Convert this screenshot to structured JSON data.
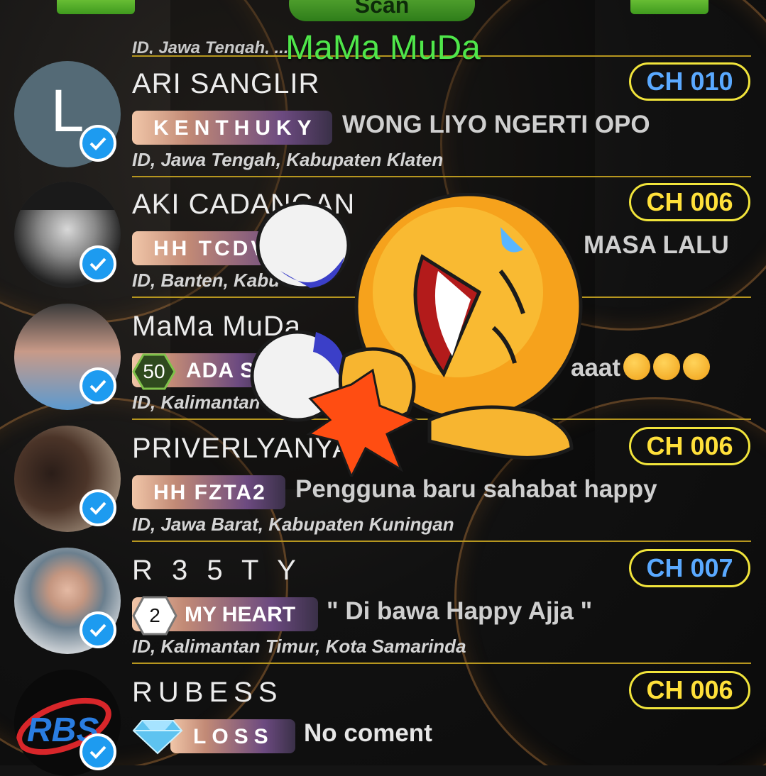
{
  "header": {
    "scan_label": "Scan",
    "room_title": "MaMa MuDa",
    "clipped_location": "ID, Jawa Tengah, ..."
  },
  "rows": [
    {
      "name": "ARI SANGLIR",
      "avatar_letter": "L",
      "badge": "KENTHUKY",
      "message": "WONG LIYO NGERTI OPO",
      "location": "ID, Jawa Tengah, Kabupaten Klaten",
      "channel": "CH 010",
      "channel_color": "#5aa9ff"
    },
    {
      "name": "AKI CADANGAN",
      "badge": "HH TCDV",
      "message": "MASA LALU",
      "location": "ID, Banten, Kabu",
      "channel": "CH 006",
      "channel_color": "#ffe03a"
    },
    {
      "name": "MaMa MuDa",
      "level": "50",
      "badge": "ADA S",
      "message": "aaat",
      "location": "ID, Kalimantan",
      "channel": "",
      "channel_color": ""
    },
    {
      "name": "PRIVERLYANYA",
      "badge": "HH FZTA2",
      "message": "Pengguna baru sahabat happy",
      "location": "ID, Jawa Barat, Kabupaten Kuningan",
      "channel": "CH 006",
      "channel_color": "#ffe03a"
    },
    {
      "name": "R 3 5 T Y",
      "level": "2",
      "badge": "MY HEART",
      "message": "\" Di bawa Happy Ajja \"",
      "location": "ID, Kalimantan Timur, Kota Samarinda",
      "channel": "CH 007",
      "channel_color": "#5aa9ff"
    },
    {
      "name": "RUBESS",
      "avatar_letter": "RBS",
      "badge": "LOSS",
      "message": "No coment",
      "location": "",
      "channel": "CH 006",
      "channel_color": "#ffe03a"
    }
  ],
  "icons": {
    "verified": "verified-check-icon",
    "diamond": "diamond-icon",
    "sticker": "laughing-emoji-sticker"
  }
}
